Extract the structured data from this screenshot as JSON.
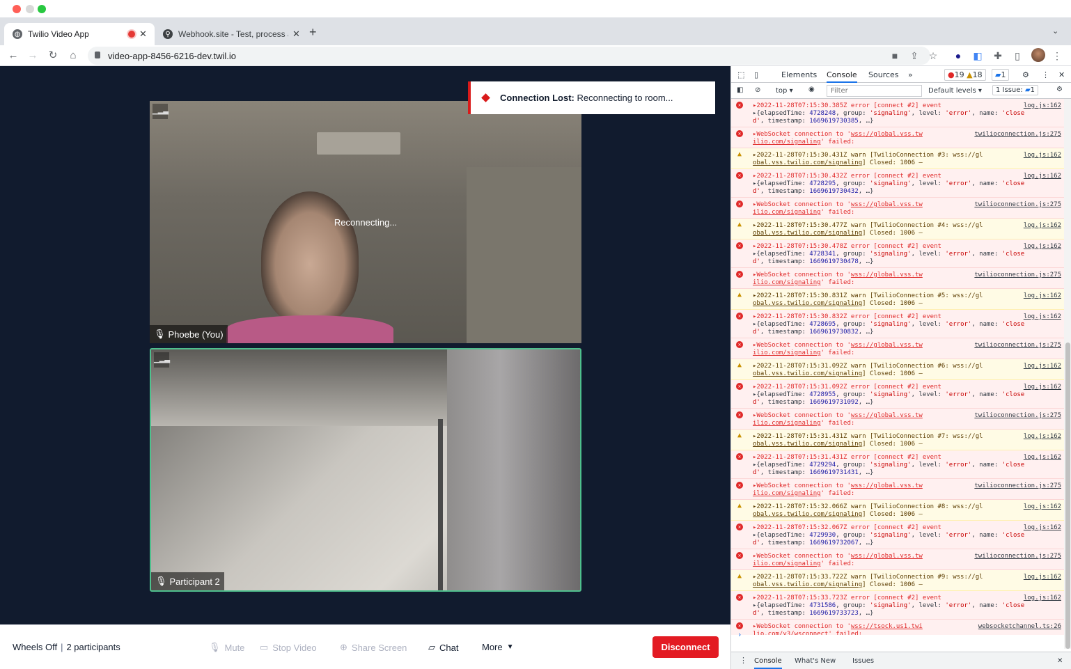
{
  "browser": {
    "tabs": [
      {
        "title": "Twilio Video App",
        "favicon": "globe-icon",
        "recording": true,
        "active": true
      },
      {
        "title": "Webhook.site - Test, process a",
        "favicon": "webhook-icon",
        "active": false
      }
    ],
    "url": "video-app-8456-6216-dev.twil.io"
  },
  "app": {
    "toast": {
      "bold": "Connection Lost:",
      "text": " Reconnecting to room..."
    },
    "reconnecting_text": "Reconnecting...",
    "participants": [
      {
        "name": "Phoebe (You)"
      },
      {
        "name": "Participant 2",
        "dominant": true
      }
    ],
    "menubar": {
      "room_name": "Wheels Off",
      "participant_count": "2 participants",
      "mute": "Mute",
      "stop_video": "Stop Video",
      "share_screen": "Share Screen",
      "chat": "Chat",
      "more": "More",
      "disconnect": "Disconnect"
    }
  },
  "devtools": {
    "tabs": [
      "Elements",
      "Console",
      "Sources"
    ],
    "error_count": "19",
    "warn_count": "18",
    "msg_count": "1",
    "context": "top",
    "filter_placeholder": "Filter",
    "levels": "Default levels",
    "issues": "1 Issue:",
    "issues_count": "1",
    "drawer_tabs": [
      "Console",
      "What's New",
      "Issues"
    ],
    "prompt": "›"
  },
  "colors": {
    "error": "#e02828",
    "warning": "#c99100",
    "disconnect": "#e31b23",
    "dominant_border": "#4fc08d",
    "app_bg": "#111b2e"
  },
  "log": [
    {
      "type": "error",
      "source": "log.js:162",
      "time": "2022-11-28T07:15:30.385Z",
      "elapsed": "4728248",
      "ts": "1669619730385"
    },
    {
      "type": "ws",
      "source": "twilioconnection.js:275",
      "url": "wss://global.vss.twilio.com/signaling"
    },
    {
      "type": "warn",
      "source": "log.js:162",
      "time": "2022-11-28T07:15:30.431Z",
      "conn": "#3"
    },
    {
      "type": "error",
      "source": "log.js:162",
      "time": "2022-11-28T07:15:30.432Z",
      "elapsed": "4728295",
      "ts": "1669619730432"
    },
    {
      "type": "ws",
      "source": "twilioconnection.js:275",
      "url": "wss://global.vss.twilio.com/signaling"
    },
    {
      "type": "warn",
      "source": "log.js:162",
      "time": "2022-11-28T07:15:30.477Z",
      "conn": "#4"
    },
    {
      "type": "error",
      "source": "log.js:162",
      "time": "2022-11-28T07:15:30.478Z",
      "elapsed": "4728341",
      "ts": "1669619730478"
    },
    {
      "type": "ws",
      "source": "twilioconnection.js:275",
      "url": "wss://global.vss.twilio.com/signaling"
    },
    {
      "type": "warn",
      "source": "log.js:162",
      "time": "2022-11-28T07:15:30.831Z",
      "conn": "#5"
    },
    {
      "type": "error",
      "source": "log.js:162",
      "time": "2022-11-28T07:15:30.832Z",
      "elapsed": "4728695",
      "ts": "1669619730832"
    },
    {
      "type": "ws",
      "source": "twilioconnection.js:275",
      "url": "wss://global.vss.twilio.com/signaling"
    },
    {
      "type": "warn",
      "source": "log.js:162",
      "time": "2022-11-28T07:15:31.092Z",
      "conn": "#6"
    },
    {
      "type": "error",
      "source": "log.js:162",
      "time": "2022-11-28T07:15:31.092Z",
      "elapsed": "4728955",
      "ts": "1669619731092"
    },
    {
      "type": "ws",
      "source": "twilioconnection.js:275",
      "url": "wss://global.vss.twilio.com/signaling"
    },
    {
      "type": "warn",
      "source": "log.js:162",
      "time": "2022-11-28T07:15:31.431Z",
      "conn": "#7"
    },
    {
      "type": "error",
      "source": "log.js:162",
      "time": "2022-11-28T07:15:31.431Z",
      "elapsed": "4729294",
      "ts": "1669619731431"
    },
    {
      "type": "ws",
      "source": "twilioconnection.js:275",
      "url": "wss://global.vss.twilio.com/signaling"
    },
    {
      "type": "warn",
      "source": "log.js:162",
      "time": "2022-11-28T07:15:32.066Z",
      "conn": "#8"
    },
    {
      "type": "error",
      "source": "log.js:162",
      "time": "2022-11-28T07:15:32.067Z",
      "elapsed": "4729930",
      "ts": "1669619732067"
    },
    {
      "type": "ws",
      "source": "twilioconnection.js:275",
      "url": "wss://global.vss.twilio.com/signaling"
    },
    {
      "type": "warn",
      "source": "log.js:162",
      "time": "2022-11-28T07:15:33.722Z",
      "conn": "#9"
    },
    {
      "type": "error",
      "source": "log.js:162",
      "time": "2022-11-28T07:15:33.723Z",
      "elapsed": "4731586",
      "ts": "1669619733723"
    },
    {
      "type": "ws",
      "source": "websocketchannel.ts:26",
      "url": "wss://tsock.us1.twilio.com/v3/wsconnect"
    }
  ]
}
